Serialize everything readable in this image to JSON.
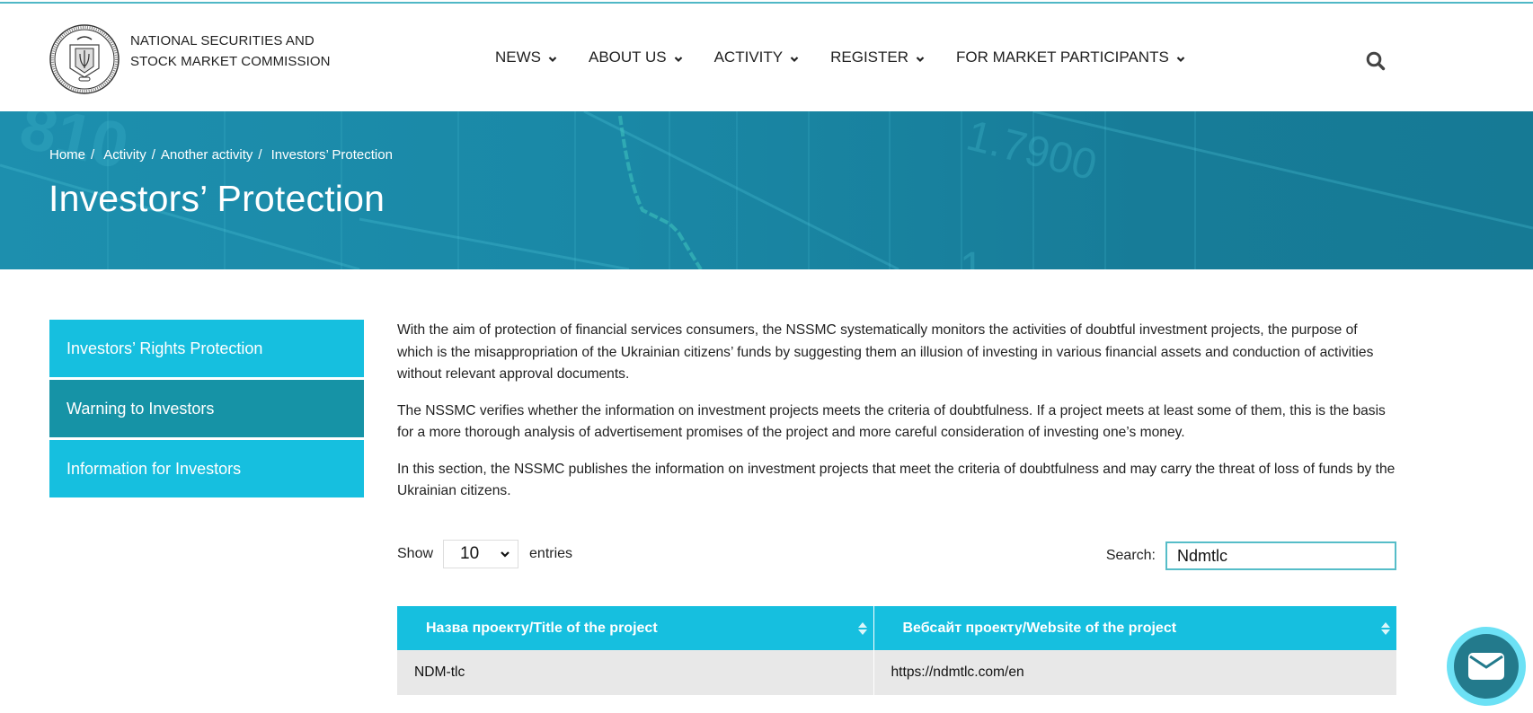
{
  "header": {
    "brand_line1": "NATIONAL SECURITIES AND",
    "brand_line2": "STOCK MARKET COMMISSION",
    "logo_icon": "state-seal-icon",
    "nav": [
      {
        "label": "NEWS",
        "icon": "chevron-down-icon"
      },
      {
        "label": "ABOUT US",
        "icon": "chevron-down-icon"
      },
      {
        "label": "ACTIVITY",
        "icon": "chevron-down-icon"
      },
      {
        "label": "REGISTER",
        "icon": "chevron-down-icon"
      },
      {
        "label": "FOR MARKET PARTICIPANTS",
        "icon": "chevron-down-icon"
      }
    ],
    "search_icon": "search-icon"
  },
  "hero": {
    "breadcrumb": [
      {
        "label": "Home"
      },
      {
        "label": "Activity"
      },
      {
        "label": "Another activity"
      },
      {
        "label": "Investors’ Protection"
      }
    ],
    "separator": "/",
    "title": "Investors’ Protection",
    "bg_digits_1": "810",
    "bg_digits_2": "1.7900",
    "bg_digits_3": "1"
  },
  "sidebar": {
    "items": [
      {
        "label": "Investors’ Rights Protection",
        "active": false
      },
      {
        "label": "Warning to Investors",
        "active": true
      },
      {
        "label": "Information for Investors",
        "active": false
      }
    ]
  },
  "content": {
    "paragraphs": [
      "With the aim of protection of financial services consumers, the NSSMC systematically monitors the activities of doubtful investment projects, the purpose of which is the misappropriation of the Ukrainian citizens’ funds by suggesting them an illusion of investing in various financial assets and conduction of activities without relevant approval documents.",
      "The NSSMC verifies whether the information on investment projects meets the criteria of doubtfulness. If a project meets at least some of them, this is the basis for a more thorough analysis of advertisement promises of the project and more careful consideration of investing one’s money.",
      "In this section, the NSSMC publishes the information on investment projects that meet the criteria of doubtfulness and may carry the threat of loss of funds by the Ukrainian citizens."
    ]
  },
  "table_controls": {
    "show_label": "Show",
    "entries_value": "10",
    "entries_label": "entries",
    "search_label": "Search:",
    "search_value": "Ndmtlc"
  },
  "table": {
    "columns": [
      "Назва проекту/Title of the project",
      "Вебсайт проекту/Website of the project"
    ],
    "rows": [
      [
        "NDM-tlc",
        "https://ndmtlc.com/en"
      ]
    ]
  },
  "floating": {
    "icon": "envelope-icon"
  },
  "colors": {
    "accent": "#16bfdf",
    "active": "#1693a6",
    "hero": "#1a88a6",
    "mail_ring": "#6ce1f5",
    "mail_inner": "#237a8c"
  }
}
